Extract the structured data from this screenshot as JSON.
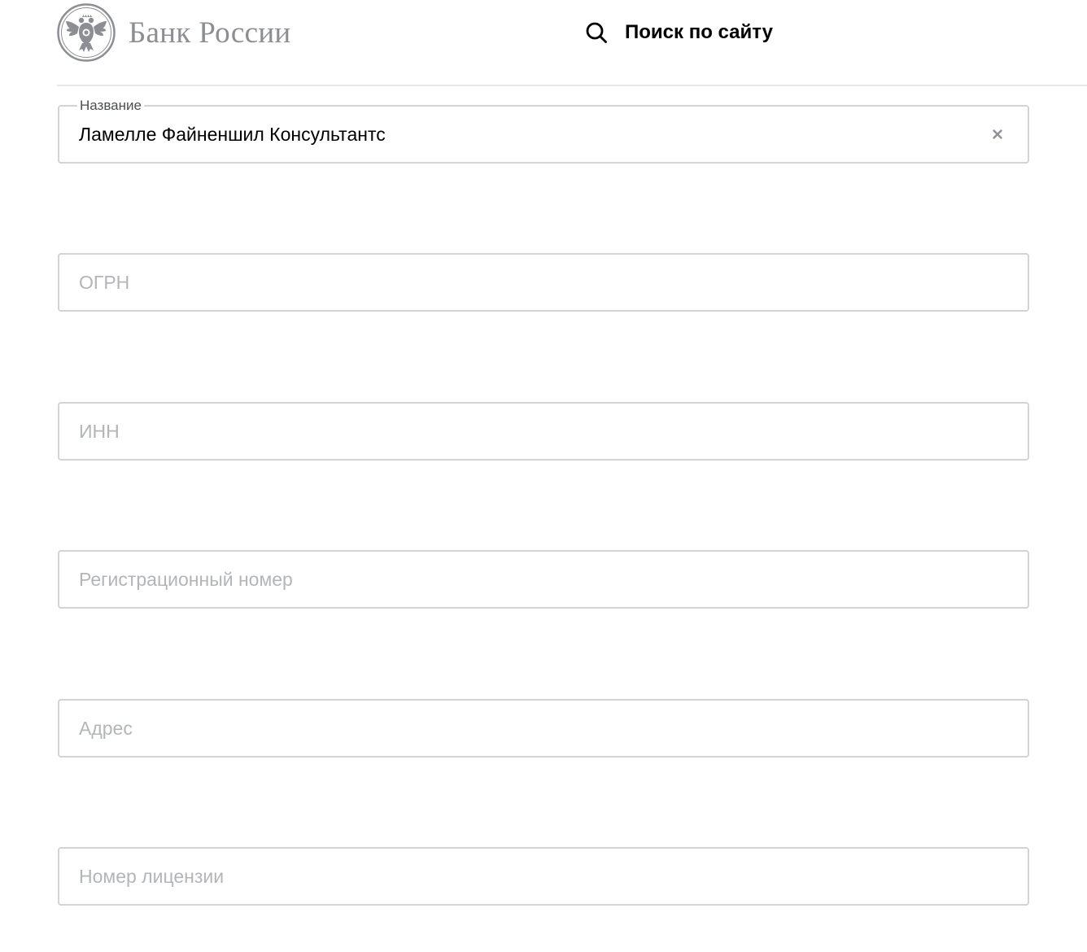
{
  "header": {
    "brand_name": "Банк России",
    "search_label": "Поиск по сайту",
    "icons": {
      "logo": "double-headed-eagle-emblem",
      "search": "search-icon"
    }
  },
  "form": {
    "name_field": {
      "label": "Название",
      "value": "Ламелле Файненшил Консультантс",
      "clear_icon": "close-icon"
    },
    "ogrn_field": {
      "placeholder": "ОГРН"
    },
    "inn_field": {
      "placeholder": "ИНН"
    },
    "reg_number_field": {
      "placeholder": "Регистрационный номер"
    },
    "address_field": {
      "placeholder": "Адрес"
    },
    "license_number_field": {
      "placeholder": "Номер лицензии"
    }
  },
  "colors": {
    "brand_gray": "#8c8e93",
    "border": "#d3d4d7",
    "placeholder": "#b3b5b9",
    "label": "#4d4e52",
    "text": "#000000"
  }
}
